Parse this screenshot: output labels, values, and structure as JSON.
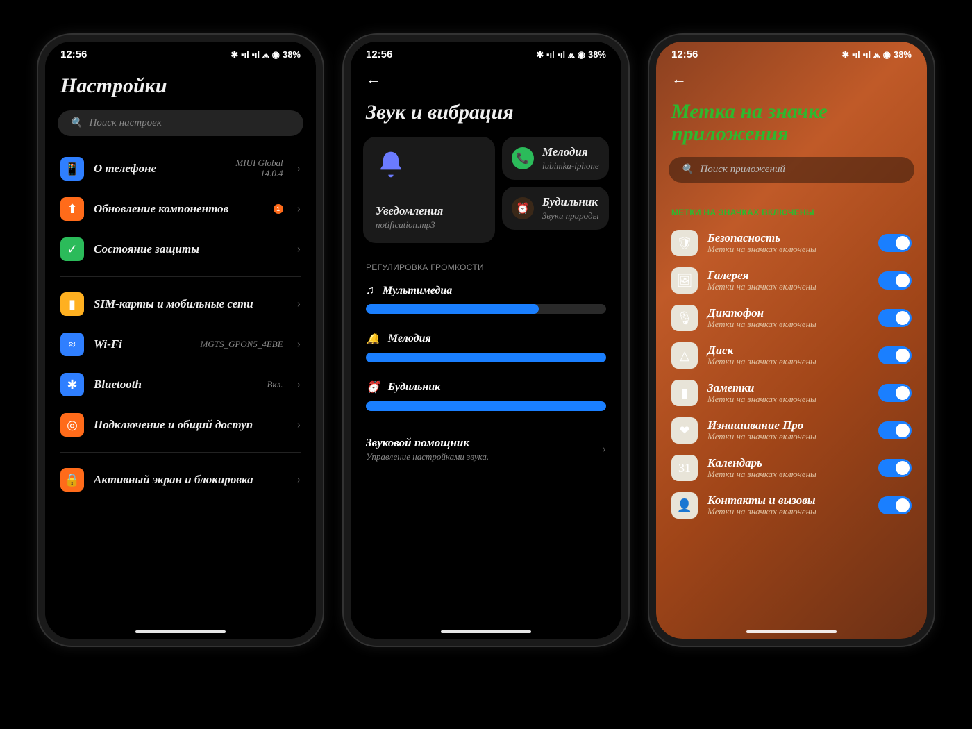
{
  "status": {
    "time": "12:56",
    "battery": "38%"
  },
  "phone1": {
    "title": "Настройки",
    "search_placeholder": "Поиск настроек",
    "items": [
      {
        "label": "О телефоне",
        "value": "MIUI Global\n14.0.4",
        "icon": "📱",
        "bg": "#2f7fff"
      },
      {
        "label": "Обновление компонентов",
        "value": "",
        "badge": "1",
        "icon": "⬆",
        "bg": "#ff6b1a"
      },
      {
        "label": "Состояние защиты",
        "value": "",
        "icon": "✓",
        "bg": "#2bbb5a"
      }
    ],
    "items2": [
      {
        "label": "SIM-карты и мобильные сети",
        "value": "",
        "icon": "▮",
        "bg": "#ffb020"
      },
      {
        "label": "Wi-Fi",
        "value": "MGTS_GPON5_4EBE",
        "icon": "≈",
        "bg": "#2f7fff"
      },
      {
        "label": "Bluetooth",
        "value": "Вкл.",
        "icon": "✱",
        "bg": "#2f7fff"
      },
      {
        "label": "Подключение и общий доступ",
        "value": "",
        "icon": "◎",
        "bg": "#ff6b1a"
      }
    ],
    "items3": [
      {
        "label": "Активный экран и блокировка",
        "value": "",
        "icon": "🔒",
        "bg": "#ff6b1a"
      }
    ]
  },
  "phone2": {
    "title": "Звук и вибрация",
    "notif_card": {
      "title": "Уведомления",
      "sub": "notification.mp3"
    },
    "ringtone_card": {
      "title": "Мелодия",
      "sub": "lubimka-iphone"
    },
    "alarm_card": {
      "title": "Будильник",
      "sub": "Звуки природы"
    },
    "volume_header": "РЕГУЛИРОВКА ГРОМКОСТИ",
    "volumes": [
      {
        "label": "Мультимедиа",
        "icon": "♫",
        "level": 72
      },
      {
        "label": "Мелодия",
        "icon": "🔔",
        "level": 100
      },
      {
        "label": "Будильник",
        "icon": "⏰",
        "level": 100
      }
    ],
    "assist": {
      "title": "Звуковой помощник",
      "sub": "Управление настройками звука."
    }
  },
  "phone3": {
    "title": "Метка на значке приложения",
    "search_placeholder": "Поиск приложений",
    "section": "МЕТКИ НА ЗНАЧКАХ ВКЛЮЧЕНЫ",
    "sub_text": "Метки на значках включены",
    "apps": [
      {
        "name": "Безопасность",
        "icon": "🛡"
      },
      {
        "name": "Галерея",
        "icon": "🖼"
      },
      {
        "name": "Диктофон",
        "icon": "🎙"
      },
      {
        "name": "Диск",
        "icon": "△"
      },
      {
        "name": "Заметки",
        "icon": "▮"
      },
      {
        "name": "Изнашивание Про",
        "icon": "❤"
      },
      {
        "name": "Календарь",
        "icon": "31"
      },
      {
        "name": "Контакты и вызовы",
        "icon": "👤"
      }
    ]
  }
}
